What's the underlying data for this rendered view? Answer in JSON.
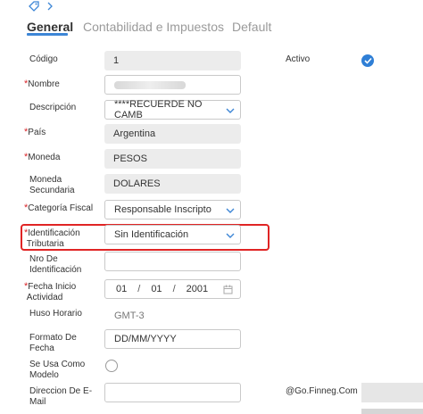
{
  "tabs": [
    {
      "label": "General"
    },
    {
      "label": "Contabilidad e Impuestos"
    },
    {
      "label": "Default"
    }
  ],
  "form": {
    "codigo": {
      "label": "Código",
      "value": "1"
    },
    "nombre": {
      "label": "Nombre",
      "value": ""
    },
    "descripcion": {
      "label": "Descripción",
      "value": "****RECUERDE NO CAMB"
    },
    "pais": {
      "label": "País",
      "value": "Argentina"
    },
    "moneda": {
      "label": "Moneda",
      "value": "PESOS"
    },
    "moneda_secundaria": {
      "label_line1": "Moneda",
      "label_line2": "Secundaria",
      "value": "DOLARES"
    },
    "categoria_fiscal": {
      "label": "Categoría Fiscal",
      "value": "Responsable Inscripto"
    },
    "identificacion_tributaria": {
      "label_line1": "Identificación",
      "label_line2": "Tributaria",
      "value": "Sin Identificación"
    },
    "nro_identificacion": {
      "label_line1": "Nro De",
      "label_line2": "Identificación",
      "value": ""
    },
    "fecha_inicio": {
      "label_line1": "Fecha Inicio",
      "label_line2": "Actividad",
      "day": "01",
      "month": "01",
      "year": "2001",
      "sep": "/"
    },
    "huso_horario": {
      "label": "Huso Horario",
      "value": "GMT-3"
    },
    "formato_fecha": {
      "label_line1": "Formato De",
      "label_line2": "Fecha",
      "value": "DD/MM/YYYY"
    },
    "usa_como_modelo": {
      "label_line1": "Se Usa Como",
      "label_line2": "Modelo",
      "checked": false
    },
    "email": {
      "label_line1": "Direccion De E-",
      "label_line2": "Mail",
      "value": ""
    },
    "activo": {
      "label": "Activo",
      "checked": true
    },
    "email_domain": {
      "value": "@Go.Finneg.Com"
    }
  },
  "required_marker": "*",
  "colors": {
    "accent": "#3d86d6",
    "required": "#d9262a",
    "highlight": "#e02424"
  }
}
